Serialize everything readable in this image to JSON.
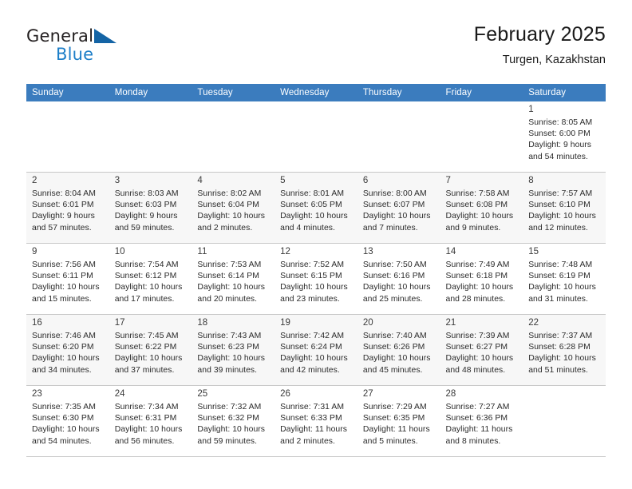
{
  "brand": {
    "name_part1": "General",
    "name_part2": "Blue",
    "logo_icon": "blue-triangle-flag-icon"
  },
  "header": {
    "title": "February 2025",
    "subtitle": "Turgen, Kazakhstan"
  },
  "colors": {
    "header_row_background": "#3b7cbe",
    "header_row_text": "#ffffff",
    "brand_blue": "#1d7ec8",
    "logo_blue": "#1464a5",
    "alt_row_background": "#f7f7f7",
    "cell_border": "#c8c8c8"
  },
  "calendar": {
    "weekday_headers": [
      "Sunday",
      "Monday",
      "Tuesday",
      "Wednesday",
      "Thursday",
      "Friday",
      "Saturday"
    ],
    "weeks": [
      [
        {
          "day": "",
          "sunrise": "",
          "sunset": "",
          "daylight_line1": "",
          "daylight_line2": "",
          "empty": true
        },
        {
          "day": "",
          "sunrise": "",
          "sunset": "",
          "daylight_line1": "",
          "daylight_line2": "",
          "empty": true
        },
        {
          "day": "",
          "sunrise": "",
          "sunset": "",
          "daylight_line1": "",
          "daylight_line2": "",
          "empty": true
        },
        {
          "day": "",
          "sunrise": "",
          "sunset": "",
          "daylight_line1": "",
          "daylight_line2": "",
          "empty": true
        },
        {
          "day": "",
          "sunrise": "",
          "sunset": "",
          "daylight_line1": "",
          "daylight_line2": "",
          "empty": true
        },
        {
          "day": "",
          "sunrise": "",
          "sunset": "",
          "daylight_line1": "",
          "daylight_line2": "",
          "empty": true
        },
        {
          "day": "1",
          "sunrise": "Sunrise: 8:05 AM",
          "sunset": "Sunset: 6:00 PM",
          "daylight_line1": "Daylight: 9 hours",
          "daylight_line2": "and 54 minutes."
        }
      ],
      [
        {
          "day": "2",
          "sunrise": "Sunrise: 8:04 AM",
          "sunset": "Sunset: 6:01 PM",
          "daylight_line1": "Daylight: 9 hours",
          "daylight_line2": "and 57 minutes."
        },
        {
          "day": "3",
          "sunrise": "Sunrise: 8:03 AM",
          "sunset": "Sunset: 6:03 PM",
          "daylight_line1": "Daylight: 9 hours",
          "daylight_line2": "and 59 minutes."
        },
        {
          "day": "4",
          "sunrise": "Sunrise: 8:02 AM",
          "sunset": "Sunset: 6:04 PM",
          "daylight_line1": "Daylight: 10 hours",
          "daylight_line2": "and 2 minutes."
        },
        {
          "day": "5",
          "sunrise": "Sunrise: 8:01 AM",
          "sunset": "Sunset: 6:05 PM",
          "daylight_line1": "Daylight: 10 hours",
          "daylight_line2": "and 4 minutes."
        },
        {
          "day": "6",
          "sunrise": "Sunrise: 8:00 AM",
          "sunset": "Sunset: 6:07 PM",
          "daylight_line1": "Daylight: 10 hours",
          "daylight_line2": "and 7 minutes."
        },
        {
          "day": "7",
          "sunrise": "Sunrise: 7:58 AM",
          "sunset": "Sunset: 6:08 PM",
          "daylight_line1": "Daylight: 10 hours",
          "daylight_line2": "and 9 minutes."
        },
        {
          "day": "8",
          "sunrise": "Sunrise: 7:57 AM",
          "sunset": "Sunset: 6:10 PM",
          "daylight_line1": "Daylight: 10 hours",
          "daylight_line2": "and 12 minutes."
        }
      ],
      [
        {
          "day": "9",
          "sunrise": "Sunrise: 7:56 AM",
          "sunset": "Sunset: 6:11 PM",
          "daylight_line1": "Daylight: 10 hours",
          "daylight_line2": "and 15 minutes."
        },
        {
          "day": "10",
          "sunrise": "Sunrise: 7:54 AM",
          "sunset": "Sunset: 6:12 PM",
          "daylight_line1": "Daylight: 10 hours",
          "daylight_line2": "and 17 minutes."
        },
        {
          "day": "11",
          "sunrise": "Sunrise: 7:53 AM",
          "sunset": "Sunset: 6:14 PM",
          "daylight_line1": "Daylight: 10 hours",
          "daylight_line2": "and 20 minutes."
        },
        {
          "day": "12",
          "sunrise": "Sunrise: 7:52 AM",
          "sunset": "Sunset: 6:15 PM",
          "daylight_line1": "Daylight: 10 hours",
          "daylight_line2": "and 23 minutes."
        },
        {
          "day": "13",
          "sunrise": "Sunrise: 7:50 AM",
          "sunset": "Sunset: 6:16 PM",
          "daylight_line1": "Daylight: 10 hours",
          "daylight_line2": "and 25 minutes."
        },
        {
          "day": "14",
          "sunrise": "Sunrise: 7:49 AM",
          "sunset": "Sunset: 6:18 PM",
          "daylight_line1": "Daylight: 10 hours",
          "daylight_line2": "and 28 minutes."
        },
        {
          "day": "15",
          "sunrise": "Sunrise: 7:48 AM",
          "sunset": "Sunset: 6:19 PM",
          "daylight_line1": "Daylight: 10 hours",
          "daylight_line2": "and 31 minutes."
        }
      ],
      [
        {
          "day": "16",
          "sunrise": "Sunrise: 7:46 AM",
          "sunset": "Sunset: 6:20 PM",
          "daylight_line1": "Daylight: 10 hours",
          "daylight_line2": "and 34 minutes."
        },
        {
          "day": "17",
          "sunrise": "Sunrise: 7:45 AM",
          "sunset": "Sunset: 6:22 PM",
          "daylight_line1": "Daylight: 10 hours",
          "daylight_line2": "and 37 minutes."
        },
        {
          "day": "18",
          "sunrise": "Sunrise: 7:43 AM",
          "sunset": "Sunset: 6:23 PM",
          "daylight_line1": "Daylight: 10 hours",
          "daylight_line2": "and 39 minutes."
        },
        {
          "day": "19",
          "sunrise": "Sunrise: 7:42 AM",
          "sunset": "Sunset: 6:24 PM",
          "daylight_line1": "Daylight: 10 hours",
          "daylight_line2": "and 42 minutes."
        },
        {
          "day": "20",
          "sunrise": "Sunrise: 7:40 AM",
          "sunset": "Sunset: 6:26 PM",
          "daylight_line1": "Daylight: 10 hours",
          "daylight_line2": "and 45 minutes."
        },
        {
          "day": "21",
          "sunrise": "Sunrise: 7:39 AM",
          "sunset": "Sunset: 6:27 PM",
          "daylight_line1": "Daylight: 10 hours",
          "daylight_line2": "and 48 minutes."
        },
        {
          "day": "22",
          "sunrise": "Sunrise: 7:37 AM",
          "sunset": "Sunset: 6:28 PM",
          "daylight_line1": "Daylight: 10 hours",
          "daylight_line2": "and 51 minutes."
        }
      ],
      [
        {
          "day": "23",
          "sunrise": "Sunrise: 7:35 AM",
          "sunset": "Sunset: 6:30 PM",
          "daylight_line1": "Daylight: 10 hours",
          "daylight_line2": "and 54 minutes."
        },
        {
          "day": "24",
          "sunrise": "Sunrise: 7:34 AM",
          "sunset": "Sunset: 6:31 PM",
          "daylight_line1": "Daylight: 10 hours",
          "daylight_line2": "and 56 minutes."
        },
        {
          "day": "25",
          "sunrise": "Sunrise: 7:32 AM",
          "sunset": "Sunset: 6:32 PM",
          "daylight_line1": "Daylight: 10 hours",
          "daylight_line2": "and 59 minutes."
        },
        {
          "day": "26",
          "sunrise": "Sunrise: 7:31 AM",
          "sunset": "Sunset: 6:33 PM",
          "daylight_line1": "Daylight: 11 hours",
          "daylight_line2": "and 2 minutes."
        },
        {
          "day": "27",
          "sunrise": "Sunrise: 7:29 AM",
          "sunset": "Sunset: 6:35 PM",
          "daylight_line1": "Daylight: 11 hours",
          "daylight_line2": "and 5 minutes."
        },
        {
          "day": "28",
          "sunrise": "Sunrise: 7:27 AM",
          "sunset": "Sunset: 6:36 PM",
          "daylight_line1": "Daylight: 11 hours",
          "daylight_line2": "and 8 minutes."
        },
        {
          "day": "",
          "sunrise": "",
          "sunset": "",
          "daylight_line1": "",
          "daylight_line2": "",
          "empty": true
        }
      ]
    ]
  }
}
